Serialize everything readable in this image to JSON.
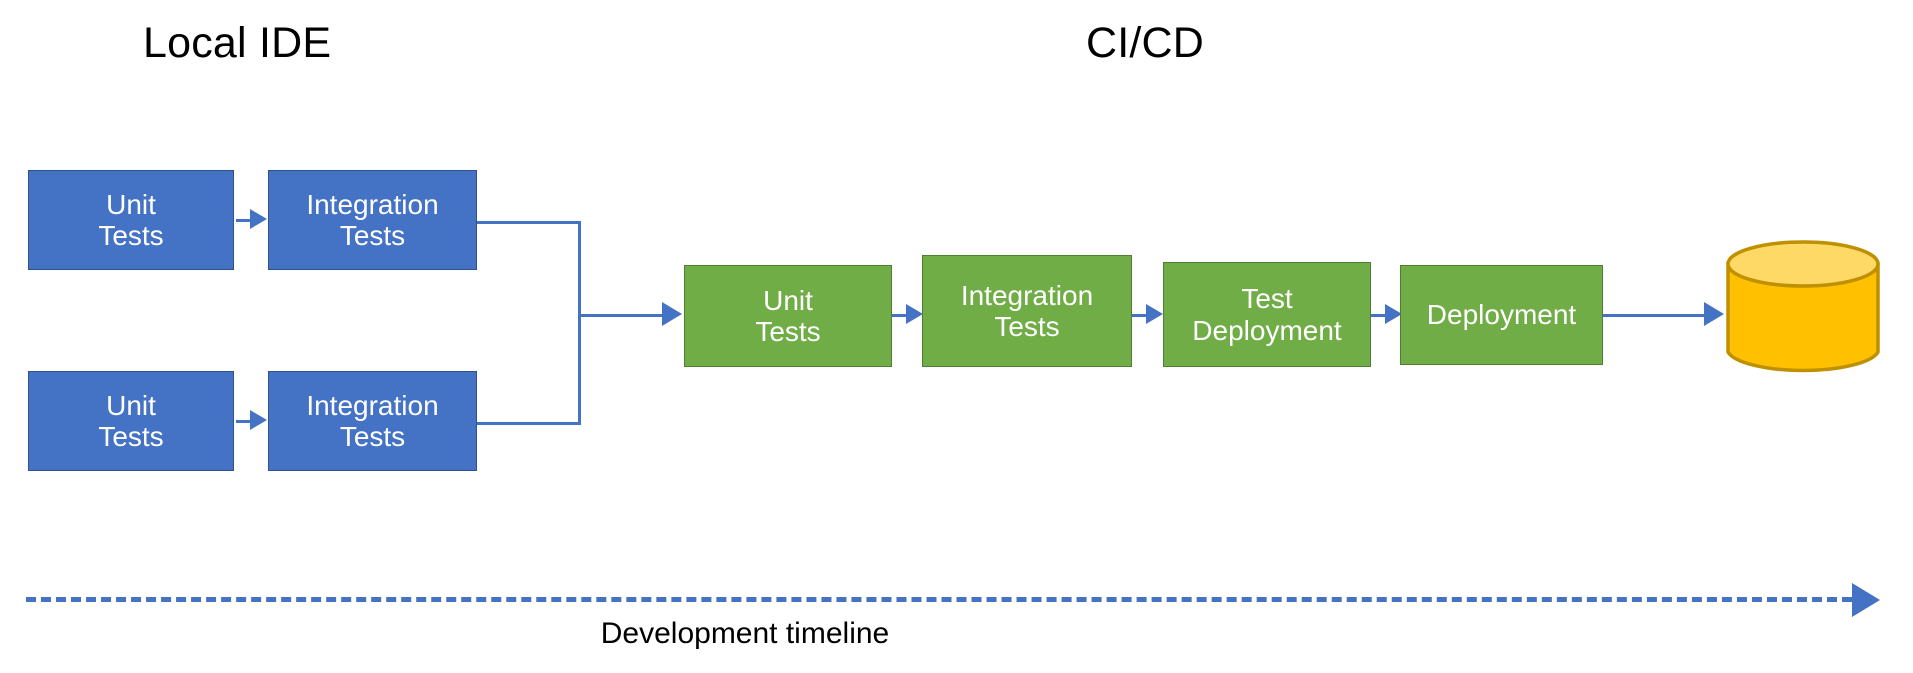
{
  "diagram": {
    "title_local": "Local IDE",
    "title_cicd": "CI/CD",
    "timeline_label": "Development timeline",
    "colors": {
      "blue_fill": "#4472c4",
      "blue_stroke": "#2f528f",
      "green_fill": "#70ad47",
      "green_stroke": "#507e32",
      "database_fill": "#ffc000",
      "database_top": "#ffd966",
      "database_stroke": "#bf9000",
      "connector": "#4472c4",
      "text_dark": "#000000",
      "text_light": "#ffffff",
      "background": "#ffffff"
    },
    "local_ide": {
      "lane_1": [
        {
          "label": "Unit\nTests",
          "name": "unit-tests"
        },
        {
          "label": "Integration\nTests",
          "name": "integration-tests"
        }
      ],
      "lane_2": [
        {
          "label": "Unit\nTests",
          "name": "unit-tests"
        },
        {
          "label": "Integration\nTests",
          "name": "integration-tests"
        }
      ]
    },
    "cicd": {
      "stages": [
        {
          "label": "Unit\nTests",
          "name": "unit-tests"
        },
        {
          "label": "Integration\nTests",
          "name": "integration-tests"
        },
        {
          "label": "Test\nDeployment",
          "name": "test-deployment"
        },
        {
          "label": "Deployment",
          "name": "deployment"
        }
      ]
    },
    "database": {
      "name": "database-cylinder",
      "label": ""
    },
    "icons": {
      "arrow_right": "arrow-right-icon",
      "database": "database-icon",
      "timeline_arrow": "timeline-arrow-icon"
    }
  }
}
